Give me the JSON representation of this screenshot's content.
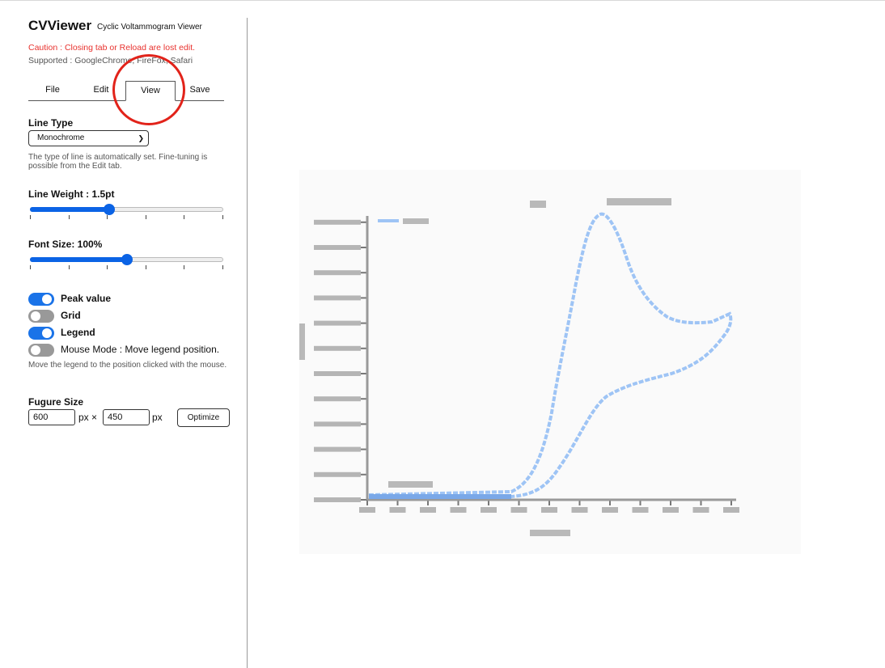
{
  "app": {
    "title": "CVViewer",
    "subtitle": "Cyclic Voltammogram Viewer",
    "caution": "Caution : Closing tab or Reload are lost edit.",
    "supported": "Supported : GoogleChrome, FireFox, Safari"
  },
  "tabs": [
    {
      "label": "File",
      "active": false
    },
    {
      "label": "Edit",
      "active": false
    },
    {
      "label": "View",
      "active": true
    },
    {
      "label": "Save",
      "active": false
    }
  ],
  "view": {
    "line_type_label": "Line Type",
    "line_type_value": "Monochrome",
    "line_type_help": "The type of line is automatically set. Fine-tuning is possible from the Edit tab.",
    "line_weight_label": "Line Weight : 1.5pt",
    "line_weight_fraction": 0.41,
    "font_size_label": "Font Size: 100%",
    "font_size_fraction": 0.5,
    "toggles": [
      {
        "label": "Peak value",
        "on": true,
        "bold": true
      },
      {
        "label": "Grid",
        "on": false,
        "bold": true
      },
      {
        "label": "Legend",
        "on": true,
        "bold": true
      },
      {
        "label": "Mouse Mode : Move legend position.",
        "on": false,
        "bold": false
      }
    ],
    "mouse_mode_help": "Move the legend to the position clicked with the mouse.",
    "figure_size_label": "Fugure Size",
    "width_value": "600",
    "height_value": "450",
    "px_times": "px ×",
    "px": "px",
    "optimize_label": "Optimize"
  },
  "colors": {
    "accent": "#1a73e8",
    "caution": "#e8322e",
    "highlight_circle": "#e2231a",
    "curve": "#9ec4f5"
  }
}
